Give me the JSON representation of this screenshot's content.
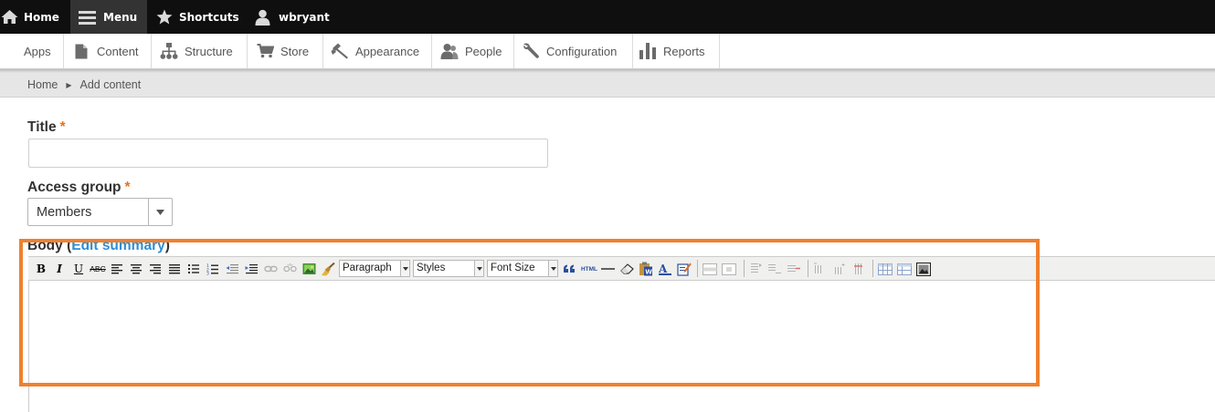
{
  "toolbar": {
    "home": "Home",
    "menu": "Menu",
    "shortcuts": "Shortcuts",
    "user": "wbryant",
    "icons": [
      "home-icon",
      "hamburger-icon",
      "star-icon",
      "user-icon"
    ]
  },
  "tray": {
    "items": [
      {
        "label": "Apps",
        "icon": ""
      },
      {
        "label": "Content",
        "icon": "page-icon"
      },
      {
        "label": "Structure",
        "icon": "sitemap-icon"
      },
      {
        "label": "Store",
        "icon": "cart-icon"
      },
      {
        "label": "Appearance",
        "icon": "paint-icon"
      },
      {
        "label": "People",
        "icon": "people-icon"
      },
      {
        "label": "Configuration",
        "icon": "wrench-icon"
      },
      {
        "label": "Reports",
        "icon": "bar-chart-icon"
      }
    ]
  },
  "breadcrumb": {
    "home": "Home",
    "current": "Add content"
  },
  "form": {
    "title_label": "Title",
    "required_mark": "*",
    "title_value": "",
    "access_label": "Access group",
    "access_value": "Members",
    "body_label": "Body",
    "body_open": "(",
    "body_close": ")",
    "edit_summary": "Edit summary"
  },
  "editor": {
    "bold": "B",
    "italic": "I",
    "underline": "U",
    "strike": "ABC",
    "html": "HTML",
    "format_value": "Paragraph",
    "styles_value": "Styles",
    "font_size_value": "Font Size",
    "body_value": ""
  },
  "colors": {
    "required": "#e8731a",
    "link": "#2d8fd5",
    "highlight": "#f0802e"
  }
}
